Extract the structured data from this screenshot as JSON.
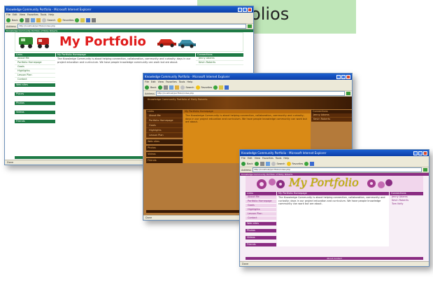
{
  "slide": {
    "title": "Portfolios"
  },
  "colors": {
    "title_box": "#bfe6b8",
    "green_theme": "#1e7a45",
    "brown_theme": "#3a1b05",
    "orange_theme": "#d98a16",
    "purple_theme": "#8a2c82",
    "portfolio_red": "#e01b1b",
    "portfolio_gold": "#c7b500",
    "xp_titlebar": "#0b3ea8"
  },
  "browser": {
    "window_title": "Knowledge Community Portfolio - Microsoft Internet Explorer",
    "menu": [
      "File",
      "Edit",
      "View",
      "Favorites",
      "Tools",
      "Help"
    ],
    "toolbar": {
      "back": "Back",
      "search": "Search",
      "favorites": "Favorites"
    },
    "address_label": "Address",
    "address_value": "http://localhost/portfolio/index.php",
    "status": "Done"
  },
  "windows": [
    {
      "theme": "green",
      "strip_text": "Knowledge Community Portfolio of Molly Roberts",
      "banner_title": "My Portfolio",
      "left_head": "Links",
      "left_items": [
        "About Me",
        "Portfolio Homepage",
        "Goals",
        "Highlights",
        "Lesson Plan",
        "Contact"
      ],
      "mid_head": "My Portfolio Homepage",
      "paragraph": "The Knowledge Community is about helping connection, collaboration, community and curiosity; days in our project education and curriculum. We have people knowledge community can work but are about.",
      "right_head": "Connections",
      "right_items": [
        "Jenny Adams",
        "Kevin Roberts"
      ],
      "sections": [
        "Web sites",
        "Places",
        "Photos",
        "Videos",
        "Friends"
      ],
      "footer": "About Contact"
    },
    {
      "theme": "brown",
      "banner_title": "Knowledge Community Portfolio of Molly Roberts",
      "left_head": "Links",
      "left_items": [
        "About Me",
        "Portfolio Homepage",
        "Goals",
        "Highlights",
        "Lesson Plan"
      ],
      "mid_head": "My Portfolio Homepage",
      "paragraph": "The Knowledge Community is about helping connection, collaboration, community and curiosity; days in our project education and curriculum. We have people knowledge community can work but are about.",
      "right_head": "Connections",
      "right_items": [
        "Jenny Adams",
        "Kevin Roberts"
      ],
      "sections": [
        "Web sites",
        "Photos",
        "Videos",
        "Friends"
      ],
      "footer": "About Contact"
    },
    {
      "theme": "purple",
      "strip_text": "Knowledge Community Portfolio of Molly Roberts",
      "banner_title": "My Portfolio",
      "left_head": "Links",
      "left_items": [
        "About Me",
        "Portfolio Homepage",
        "Goals",
        "Highlights",
        "Lesson Plan",
        "Contact"
      ],
      "mid_head": "My Portfolio Homepage",
      "paragraph": "The Knowledge Community is about helping connection, collaboration, community and curiosity; days in our project education and curriculum. We have people knowledge community can work but are about.",
      "right_head": "Connections",
      "right_items": [
        "Jenny Adams",
        "Kevin Roberts",
        "Tom Kelly"
      ],
      "sections": [
        "Web sites",
        "Photos",
        "Videos",
        "Friends"
      ],
      "footer": "About Contact"
    }
  ]
}
